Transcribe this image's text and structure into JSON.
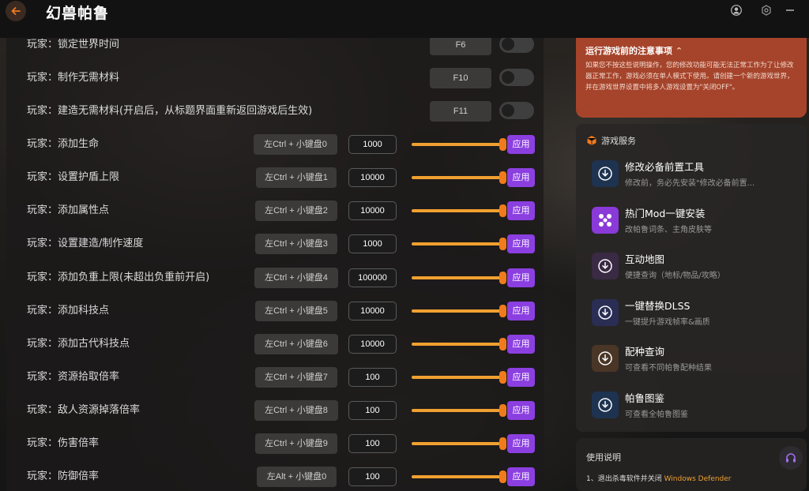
{
  "app": {
    "title": "幻兽帕鲁"
  },
  "colors": {
    "accent": "#8b3fe0",
    "slider": "#f0a030",
    "notice_bg": "#a5442b",
    "highlight": "#f0a030"
  },
  "rows": [
    {
      "label": "玩家：锁定世界时间",
      "hotkey": "F6",
      "type": "toggle"
    },
    {
      "label": "玩家：制作无需材料",
      "hotkey": "F10",
      "type": "toggle"
    },
    {
      "label": "玩家：建造无需材料(开启后，从标题界面重新返回游戏后生效)",
      "hotkey": "F11",
      "type": "toggle"
    },
    {
      "label": "玩家：添加生命",
      "hotkey": "左Ctrl + 小键盘0",
      "value": "1000",
      "type": "slider",
      "apply": "应用"
    },
    {
      "label": "玩家：设置护盾上限",
      "hotkey": "左Ctrl + 小键盘1",
      "value": "10000",
      "type": "slider",
      "apply": "应用"
    },
    {
      "label": "玩家：添加属性点",
      "hotkey": "左Ctrl + 小键盘2",
      "value": "10000",
      "type": "slider",
      "apply": "应用"
    },
    {
      "label": "玩家：设置建造/制作速度",
      "hotkey": "左Ctrl + 小键盘3",
      "value": "1000",
      "type": "slider",
      "apply": "应用"
    },
    {
      "label": "玩家：添加负重上限(未超出负重前开启)",
      "hotkey": "左Ctrl + 小键盘4",
      "value": "100000",
      "type": "slider",
      "apply": "应用"
    },
    {
      "label": "玩家：添加科技点",
      "hotkey": "左Ctrl + 小键盘5",
      "value": "10000",
      "type": "slider",
      "apply": "应用"
    },
    {
      "label": "玩家：添加古代科技点",
      "hotkey": "左Ctrl + 小键盘6",
      "value": "10000",
      "type": "slider",
      "apply": "应用"
    },
    {
      "label": "玩家：资源拾取倍率",
      "hotkey": "左Ctrl + 小键盘7",
      "value": "100",
      "type": "slider",
      "apply": "应用"
    },
    {
      "label": "玩家：敌人资源掉落倍率",
      "hotkey": "左Ctrl + 小键盘8",
      "value": "100",
      "type": "slider",
      "apply": "应用"
    },
    {
      "label": "玩家：伤害倍率",
      "hotkey": "左Ctrl + 小键盘9",
      "value": "100",
      "type": "slider",
      "apply": "应用"
    },
    {
      "label": "玩家：防御倍率",
      "hotkey": "左Alt + 小键盘0",
      "value": "100",
      "type": "slider",
      "apply": "应用"
    }
  ],
  "notice": {
    "title": "运行游戏前的注意事项",
    "text": "如果您不按这些说明操作，您的修改功能可能无法正常工作为了让修改器正常工作，游戏必须在单人模式下使用。请创建一个新的游戏世界，并在游戏世界设置中将多人游戏设置为\"关闭OFF\"。"
  },
  "services": {
    "title": "游戏服务",
    "items": [
      {
        "title": "修改必备前置工具",
        "desc": "修改前，务必先安装\"修改必备前置...",
        "icon": "download-icon",
        "color": "#1d3350"
      },
      {
        "title": "热门Mod一键安装",
        "desc": "改帕鲁词条、主角皮肤等",
        "icon": "mod-icon",
        "color": "#8a3ad8"
      },
      {
        "title": "互动地图",
        "desc": "便捷查询（地标/物品/攻略）",
        "icon": "download-icon",
        "color": "#3a2a44"
      },
      {
        "title": "一键替换DLSS",
        "desc": "一键提升游戏帧率&画质",
        "icon": "download-icon",
        "color": "#2a2e55"
      },
      {
        "title": "配种查询",
        "desc": "可查看不同帕鲁配种结果",
        "icon": "download-icon",
        "color": "#4a3626"
      },
      {
        "title": "帕鲁图鉴",
        "desc": "可查看全帕鲁图鉴",
        "icon": "download-icon",
        "color": "#1d3350"
      }
    ]
  },
  "usage": {
    "title": "使用说明",
    "step1_prefix": "1、退出杀毒软件并关闭",
    "step1_highlight": "Windows Defender"
  }
}
